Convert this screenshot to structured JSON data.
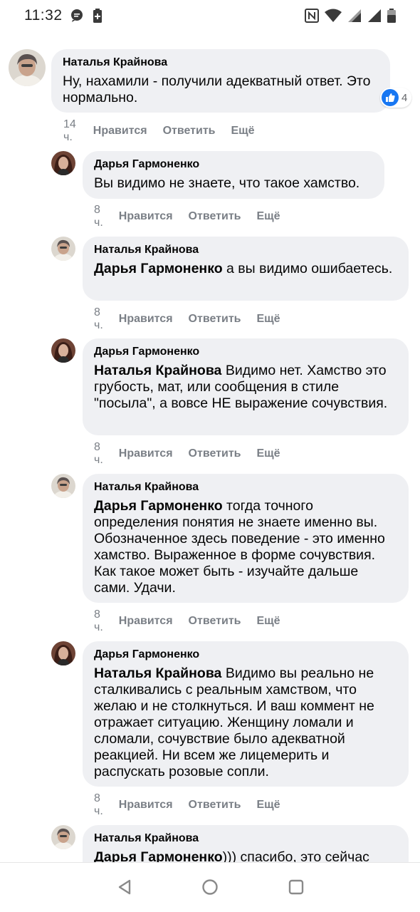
{
  "status_bar": {
    "time": "11:32",
    "icons": [
      "chat-bubble-icon",
      "battery-saver-icon",
      "nfc-icon",
      "wifi-icon",
      "signal-icon",
      "signal-icon",
      "battery-icon"
    ]
  },
  "comments": [
    {
      "author": "Наталья Крайнова",
      "mention": "",
      "text": "Ну, нахамили - получили адекватный ответ. Это нормально.",
      "time": "14 ч.",
      "like": "Нравится",
      "reply": "Ответить",
      "more": "Ещё",
      "reaction_count": "4"
    },
    {
      "author": "Дарья Гармоненко",
      "mention": "",
      "text": "Вы видимо не знаете, что такое хамство.",
      "time": "8 ч.",
      "like": "Нравится",
      "reply": "Ответить",
      "more": "Ещё"
    },
    {
      "author": "Наталья Крайнова",
      "mention": "Дарья Гармоненко",
      "text": " а вы видимо ошибаетесь.",
      "time": "8 ч.",
      "like": "Нравится",
      "reply": "Ответить",
      "more": "Ещё"
    },
    {
      "author": "Дарья Гармоненко",
      "mention": "Наталья Крайнова",
      "text": " Видимо нет. Хамство это грубость, мат, или сообщения в стиле \"посыла\", а вовсе НЕ выражение сочувствия.",
      "time": "8 ч.",
      "like": "Нравится",
      "reply": "Ответить",
      "more": "Ещё"
    },
    {
      "author": "Наталья Крайнова",
      "mention": "Дарья Гармоненко",
      "text": " тогда точного определения понятия не знаете именно вы. Обозначенное здесь поведение - это именно хамство. Выраженное в форме сочувствия. Как такое может быть - изучайте дальше сами. Удачи.",
      "time": "8 ч.",
      "like": "Нравится",
      "reply": "Ответить",
      "more": "Ещё"
    },
    {
      "author": "Дарья Гармоненко",
      "mention": "Наталья Крайнова",
      "text": " Видимо вы реально не сталкивались с реальным хамством, что желаю и не столкнуться. И ваш коммент не отражает ситуацию. Женщину ломали и сломали, сочувствие было адекватной реакцией. Ни всем же лицемерить и распускать розовые сопли.",
      "time": "8 ч.",
      "like": "Нравится",
      "reply": "Ответить",
      "more": "Ещё"
    },
    {
      "author": "Наталья Крайнова",
      "mention": "Дарья Гармоненко",
      "text": "))) спасибо, это сейчас",
      "time": "",
      "like": "",
      "reply": "",
      "more": ""
    }
  ],
  "colors": {
    "bubble": "#eff0f3",
    "meta_text": "#7a7f86",
    "like_blue": "#1877f2"
  },
  "nav_bar": {
    "icons": [
      "back-icon",
      "home-icon",
      "recents-icon"
    ]
  }
}
